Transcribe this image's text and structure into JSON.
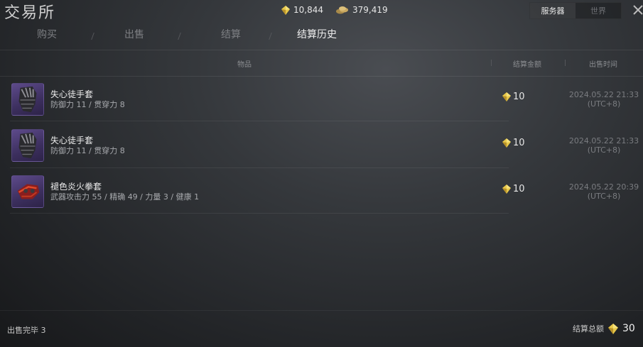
{
  "window": {
    "title": "交易所"
  },
  "currencies": [
    {
      "icon": "gem-icon",
      "value": "10,844"
    },
    {
      "icon": "coin-pile-icon",
      "value": "379,419"
    }
  ],
  "server_toggle": {
    "options": [
      "服务器",
      "世界"
    ],
    "selected": "服务器"
  },
  "tabs": [
    {
      "label": "购买",
      "active": false
    },
    {
      "label": "出售",
      "active": false
    },
    {
      "label": "结算",
      "active": false
    },
    {
      "label": "结算历史",
      "active": true
    }
  ],
  "table": {
    "headers": {
      "item": "物品",
      "amount": "结算金额",
      "time": "出售时间"
    },
    "rows": [
      {
        "name": "失心徒手套",
        "stats": "防御力 11  / 贯穿力 8",
        "icon": "dark-gauntlet-icon",
        "amount": "10",
        "date": "2024.05.22 21:33",
        "tz": "(UTC+8)"
      },
      {
        "name": "失心徒手套",
        "stats": "防御力 11  / 贯穿力 8",
        "icon": "dark-gauntlet-icon",
        "amount": "10",
        "date": "2024.05.22 21:33",
        "tz": "(UTC+8)"
      },
      {
        "name": "褪色炎火拳套",
        "stats": "武器攻击力 55  / 精确 49  / 力量 3  / 健康 1",
        "icon": "flame-gauntlet-icon",
        "amount": "10",
        "date": "2024.05.22 20:39",
        "tz": "(UTC+8)"
      }
    ]
  },
  "footer": {
    "sold_label": "出售完毕",
    "sold_count": "3",
    "total_label": "结算总额",
    "total_value": "30"
  },
  "colors": {
    "gem": "#e8c84a",
    "active_tab": "#f0f0f0",
    "inactive_tab": "#7d7f83",
    "item_frame": "#4a3b73"
  }
}
